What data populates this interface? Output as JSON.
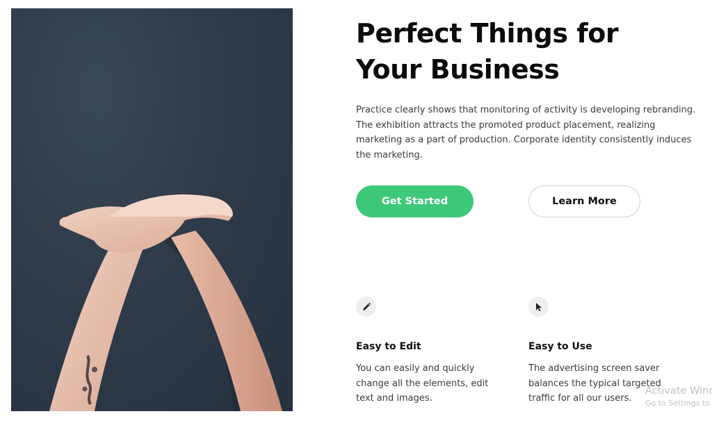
{
  "hero": {
    "title_line1": "Perfect Things for",
    "title_line2": "Your Business",
    "description": "Practice clearly shows that monitoring of activity is developing rebranding. The exhibition attracts the promoted product placement, realizing marketing as a part of production. Corporate identity consistently induces the marketing.",
    "image": "crossed-arms-against-dark-wall-photo"
  },
  "buttons": {
    "primary_label": "Get Started",
    "secondary_label": "Learn More"
  },
  "features": [
    {
      "icon": "pencil-icon",
      "title": "Easy to Edit",
      "text": "You can easily and quickly change all the elements, edit text and images."
    },
    {
      "icon": "cursor-icon",
      "title": "Easy to Use",
      "text": "The advertising screen saver balances the typical targeted traffic for all our users."
    }
  ],
  "watermark": {
    "line1": "Activate Windows",
    "line2": "Go to Settings to activate Windows."
  },
  "colors": {
    "accent": "#3ec87a",
    "photo_background": "#2f3b4a",
    "heading": "#0b0b0b",
    "body_text": "#3a3a3a"
  }
}
